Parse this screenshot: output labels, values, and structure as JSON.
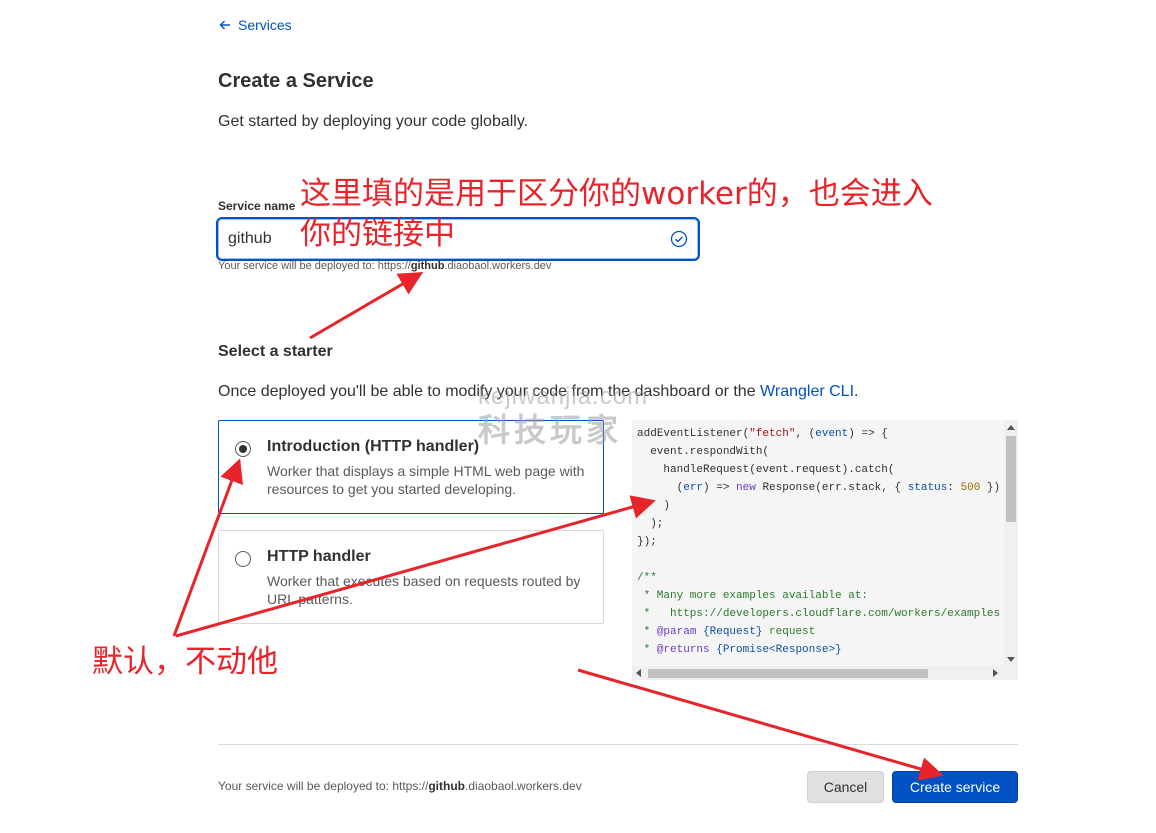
{
  "nav": {
    "back_label": "Services"
  },
  "page": {
    "title": "Create a Service",
    "subtitle": "Get started by deploying your code globally."
  },
  "service_name": {
    "label": "Service name",
    "value": "github",
    "hint_prefix": "Your service will be deployed to: https://",
    "hint_name": "github",
    "hint_suffix": ".diaobaol.workers.dev"
  },
  "starter": {
    "title": "Select a starter",
    "desc_prefix": "Once deployed you'll be able to modify your code from the dashboard or the ",
    "desc_link": "Wrangler CLI",
    "desc_suffix": ".",
    "options": [
      {
        "title": "Introduction (HTTP handler)",
        "desc": "Worker that displays a simple HTML web page with resources to get you started developing.",
        "selected": true
      },
      {
        "title": "HTTP handler",
        "desc": "Worker that executes based on requests routed by URL patterns.",
        "selected": false
      }
    ]
  },
  "code_lines": [
    "addEventListener(\"fetch\", (event) => {",
    "  event.respondWith(",
    "    handleRequest(event.request).catch(",
    "      (err) => new Response(err.stack, { status: 500 })",
    "    )",
    "  );",
    "});",
    "",
    "/**",
    " * Many more examples available at:",
    " *   https://developers.cloudflare.com/workers/examples",
    " * @param {Request} request",
    " * @returns {Promise<Response>}"
  ],
  "footer": {
    "hint_prefix": "Your service will be deployed to: https://",
    "hint_name": "github",
    "hint_suffix": ".diaobaol.workers.dev",
    "cancel_label": "Cancel",
    "create_label": "Create service"
  },
  "annotations": {
    "service_name_note": "这里填的是用于区分你的worker的，也会进入你的链接中",
    "starter_note": "默认，不动他"
  },
  "watermark": {
    "line1": "kejiwanjia.com",
    "line2": "科技玩家"
  },
  "colors": {
    "accent": "#0051c3",
    "annotation": "#e8242b"
  }
}
